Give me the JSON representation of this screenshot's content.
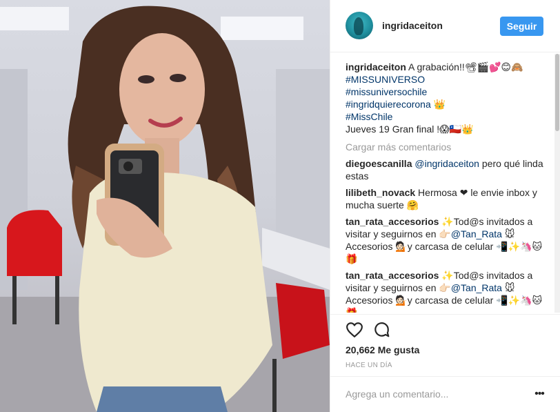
{
  "header": {
    "username": "ingridaceiton",
    "follow_label": "Seguir"
  },
  "caption": {
    "username": "ingridaceiton",
    "text": " A grabación!!📽🎬💕😊🙈",
    "tags": [
      "#MISSUNIVERSO",
      "#missuniversochile"
    ],
    "tag3": "#ingridquierecorona",
    "tag3_suffix": " 👑",
    "tag4": "#MissChile",
    "final_line": "Jueves 19 Gran final !😱🇨🇱👑"
  },
  "load_more": "Cargar más comentarios",
  "comments": [
    {
      "user": "diegoescanilla",
      "mention": "@ingridaceiton",
      "text": " pero qué linda estas"
    },
    {
      "user": "lilibeth_novack",
      "mention": "",
      "text": " Hermosa ❤ le envie inbox y mucha suerte 🤗"
    },
    {
      "user": "tan_rata_accesorios",
      "pre": " ✨Tod@s invitados a visitar y seguirnos en 👉🏻",
      "mention": "@Tan_Rata",
      "text": " 🐭 Accesorios 💁🏻y carcasa de celular 📲✨🦄🐱🎁"
    },
    {
      "user": "tan_rata_accesorios",
      "pre": " ✨Tod@s invitados a visitar y seguirnos en 👉🏻",
      "mention": "@Tan_Rata",
      "text": " 🐭 Accesorios 💁🏻y carcasa de celular 📲✨🦄🐱🎁"
    }
  ],
  "likes": "20,662 Me gusta",
  "time": "HACE UN DÍA",
  "add_comment_placeholder": "Agrega un comentario...",
  "more_label": "•••",
  "icons": {
    "like": "heart-outline-icon",
    "comment": "speech-bubble-icon",
    "more": "ellipsis-icon"
  },
  "colors": {
    "follow_button": "#3897f0",
    "link": "#003569",
    "muted": "#999999"
  }
}
